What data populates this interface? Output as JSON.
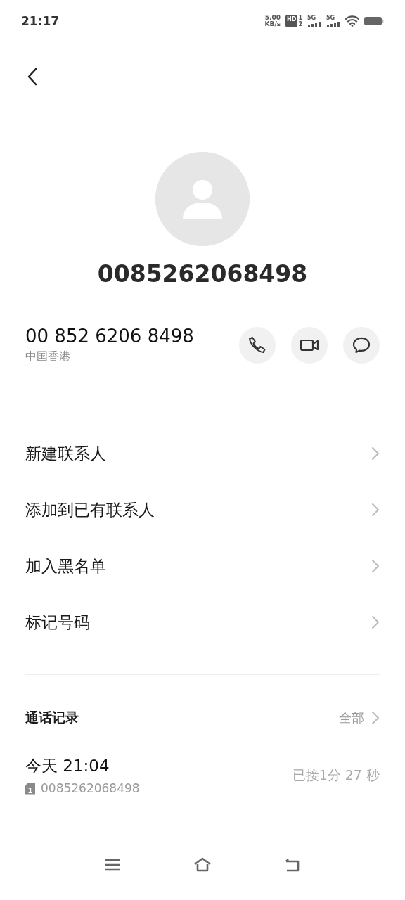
{
  "status_bar": {
    "time": "21:17",
    "net_speed": "5.00",
    "net_unit": "KB/s",
    "hd": "HD",
    "sim_slots": [
      "1",
      "2"
    ],
    "networks": [
      "5G",
      "5G"
    ]
  },
  "contact": {
    "title": "0085262068498",
    "number": "00 852 6206 8498",
    "region": "中国香港"
  },
  "actions": [
    {
      "kind": "call"
    },
    {
      "kind": "video"
    },
    {
      "kind": "message"
    }
  ],
  "menu": [
    {
      "label": "新建联系人"
    },
    {
      "label": "添加到已有联系人"
    },
    {
      "label": "加入黑名单"
    },
    {
      "label": "标记号码"
    }
  ],
  "call_log": {
    "title": "通话记录",
    "all_link": "全部",
    "entries": [
      {
        "time": "今天 21:04",
        "sim": "1",
        "number": "0085262068498",
        "status": "已接1分 27 秒"
      }
    ]
  },
  "nav_bar": [
    {
      "kind": "menu"
    },
    {
      "kind": "home"
    },
    {
      "kind": "back"
    }
  ]
}
